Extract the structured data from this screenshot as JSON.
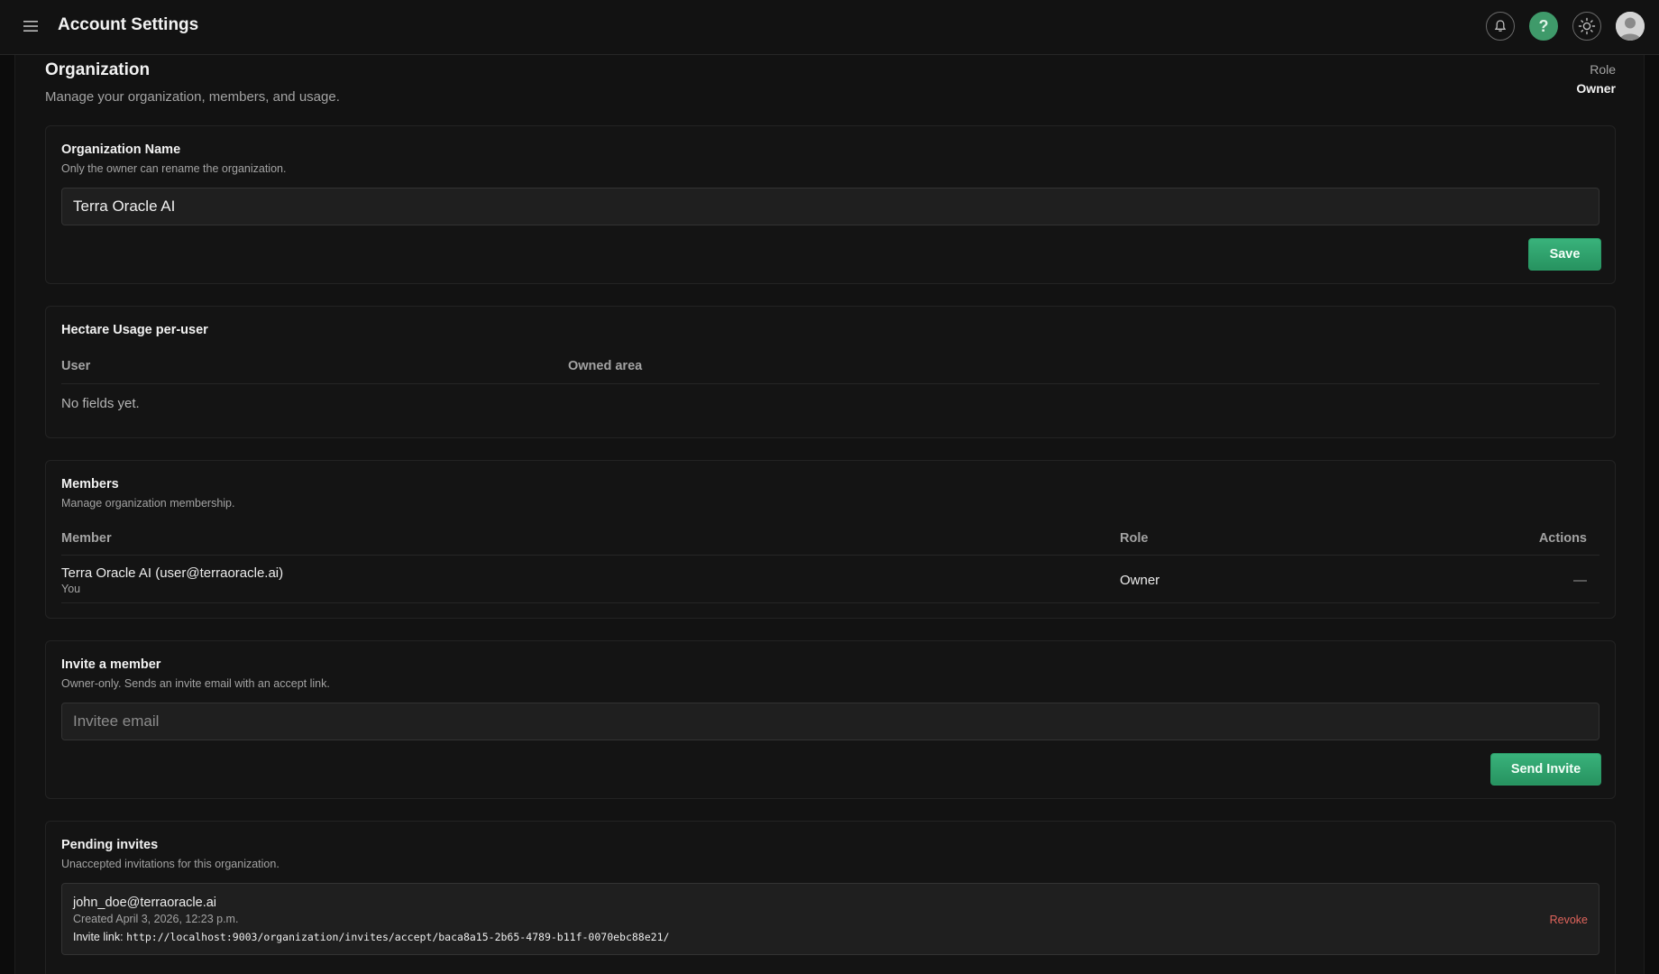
{
  "header": {
    "title": "Account Settings",
    "help_glyph": "?",
    "icons": [
      "menu-icon",
      "bell-icon",
      "help-icon",
      "sun-icon",
      "user-avatar-icon"
    ],
    "accent_color": "#3f9a6a"
  },
  "page": {
    "title": "Organization",
    "subtitle": "Manage your organization, members, and usage.",
    "role_label": "Role",
    "role_value": "Owner"
  },
  "org_name": {
    "title": "Organization Name",
    "subtitle": "Only the owner can rename the organization.",
    "value": "Terra Oracle AI",
    "save_label": "Save"
  },
  "usage": {
    "title": "Hectare Usage per-user",
    "columns": [
      "User",
      "Owned area"
    ],
    "empty_text": "No fields yet."
  },
  "members": {
    "title": "Members",
    "subtitle": "Manage organization membership.",
    "columns": [
      "Member",
      "Role",
      "Actions"
    ],
    "rows": [
      {
        "member": "Terra Oracle AI (user@terraoracle.ai)",
        "note": "You",
        "role": "Owner",
        "actions": "—"
      }
    ]
  },
  "invite": {
    "title": "Invite a member",
    "subtitle": "Owner-only. Sends an invite email with an accept link.",
    "placeholder": "Invitee email",
    "button_label": "Send Invite"
  },
  "pending": {
    "title": "Pending invites",
    "subtitle": "Unaccepted invitations for this organization.",
    "items": [
      {
        "email": "john_doe@terraoracle.ai",
        "created": "Created April 3, 2026, 12:23 p.m.",
        "link_label": "Invite link:",
        "link": "http://localhost:9003/organization/invites/accept/baca8a15-2b65-4789-b11f-0070ebc88e21/",
        "revoke_label": "Revoke"
      }
    ]
  }
}
